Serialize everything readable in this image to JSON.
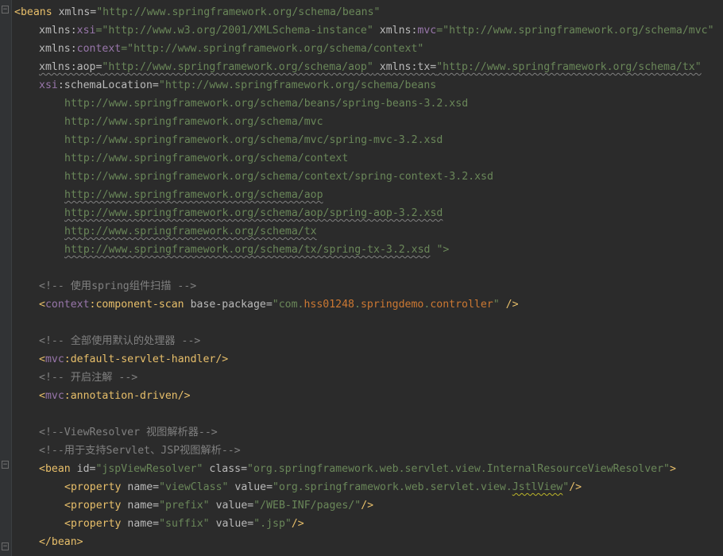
{
  "colors": {
    "background": "#2b2b2b",
    "tag": "#e8bf6a",
    "namespace": "#9876aa",
    "attribute": "#bababa",
    "string": "#6a8759",
    "highlight": "#cc7832",
    "comment": "#808080"
  },
  "code": {
    "l1": {
      "open": "<beans",
      "attr": " xmlns=",
      "value": "\"http://www.springframework.org/schema/beans\""
    },
    "l2": {
      "a1": "xmlns:",
      "n1": "xsi",
      "v1": "=\"http://www.w3.org/2001/XMLSchema-instance\"",
      "a2": " xmlns:",
      "n2": "mvc",
      "v2": "=\"http://www.springframework.org/schema/mvc\""
    },
    "l3": {
      "a1": "xmlns:",
      "n1": "context",
      "v1": "=\"http://www.springframework.org/schema/context\""
    },
    "l4": {
      "a1": "xmlns:aop=",
      "v1": "\"http://www.springframework.org/schema/aop\"",
      "a2": " xmlns:tx=",
      "v2": "\"http://www.springframework.org/schema/tx\""
    },
    "l5": {
      "n1": "xsi",
      "a1": ":schemaLocation=",
      "v1": "\"http://www.springframework.org/schema/beans"
    },
    "urls": [
      "http://www.springframework.org/schema/beans/spring-beans-3.2.xsd",
      "http://www.springframework.org/schema/mvc",
      "http://www.springframework.org/schema/mvc/spring-mvc-3.2.xsd",
      "http://www.springframework.org/schema/context",
      "http://www.springframework.org/schema/context/spring-context-3.2.xsd"
    ],
    "squig_urls": [
      "http://www.springframework.org/schema/aop",
      "http://www.springframework.org/schema/aop/spring-aop-3.2.xsd",
      "http://www.springframework.org/schema/tx"
    ],
    "last_url": "http://www.springframework.org/schema/tx/spring-tx-3.2.xsd",
    "last_url_end": " \">",
    "c1": "<!-- 使用spring组件扫描 -->",
    "scan": {
      "open": "<",
      "ns": "context",
      "tag": ":component-scan",
      "attr": " base-package=",
      "q1": "\"com.",
      "h1": "hss01248",
      "dot": ".",
      "h2": "springdemo",
      "dot2": ".",
      "h3": "controller",
      "q2": "\"",
      "close": " />"
    },
    "c2": "<!-- 全部使用默认的处理器 -->",
    "dsh": {
      "open": "<",
      "ns": "mvc",
      "tag": ":default-servlet-handler/>"
    },
    "c3": "<!-- 开启注解 -->",
    "ad": {
      "open": "<",
      "ns": "mvc",
      "tag": ":annotation-driven/>"
    },
    "c4": "<!--ViewResolver 视图解析器-->",
    "c5": "<!--用于支持Servlet、JSP视图解析-->",
    "bean": {
      "open": "<bean",
      "a1": " id=",
      "v1": "\"jspViewResolver\"",
      "a2": " class=",
      "v2": "\"org.springframework.web.servlet.view.InternalResourceViewResolver\"",
      "close": ">"
    },
    "p1": {
      "open": "<property",
      "a1": " name=",
      "v1": "\"viewClass\"",
      "a2": " value=",
      "v2a": "\"org.springframework.web.servlet.view.",
      "v2b": "JstlView",
      "v2c": "\"",
      "close": "/>"
    },
    "p2": {
      "open": "<property",
      "a1": " name=",
      "v1": "\"prefix\"",
      "a2": " value=",
      "v2": "\"/WEB-INF/pages/\"",
      "close": "/>"
    },
    "p3": {
      "open": "<property",
      "a1": " name=",
      "v1": "\"suffix\"",
      "a2": " value=",
      "v2": "\".jsp\"",
      "close": "/>"
    },
    "end_bean": "</bean>"
  }
}
